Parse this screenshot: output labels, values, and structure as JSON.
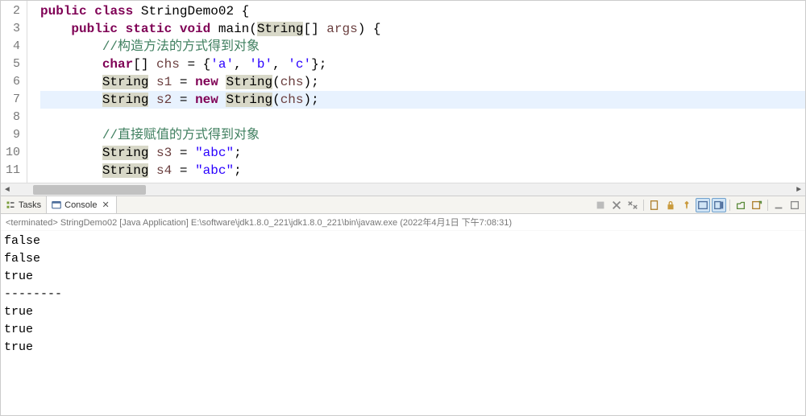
{
  "gutter": [
    "2",
    "3",
    "4",
    "5",
    "6",
    "7",
    "8",
    "9",
    "10",
    "11"
  ],
  "code": {
    "highlight_index": 5,
    "lines": [
      [
        {
          "cls": "kw",
          "t": "public"
        },
        {
          "cls": "plain",
          "t": " "
        },
        {
          "cls": "kw",
          "t": "class"
        },
        {
          "cls": "plain",
          "t": " StringDemo02 {"
        }
      ],
      [
        {
          "cls": "plain",
          "t": "    "
        },
        {
          "cls": "kw",
          "t": "public"
        },
        {
          "cls": "plain",
          "t": " "
        },
        {
          "cls": "kw",
          "t": "static"
        },
        {
          "cls": "plain",
          "t": " "
        },
        {
          "cls": "kw",
          "t": "void"
        },
        {
          "cls": "plain",
          "t": " main("
        },
        {
          "cls": "typehl",
          "t": "String"
        },
        {
          "cls": "plain",
          "t": "[] "
        },
        {
          "cls": "var",
          "t": "args"
        },
        {
          "cls": "plain",
          "t": ") {"
        }
      ],
      [
        {
          "cls": "plain",
          "t": "        "
        },
        {
          "cls": "cmt",
          "t": "//构造方法的方式得到对象"
        }
      ],
      [
        {
          "cls": "plain",
          "t": "        "
        },
        {
          "cls": "kw",
          "t": "char"
        },
        {
          "cls": "plain",
          "t": "[] "
        },
        {
          "cls": "var",
          "t": "chs"
        },
        {
          "cls": "plain",
          "t": " = {"
        },
        {
          "cls": "str",
          "t": "'a'"
        },
        {
          "cls": "plain",
          "t": ", "
        },
        {
          "cls": "str",
          "t": "'b'"
        },
        {
          "cls": "plain",
          "t": ", "
        },
        {
          "cls": "str",
          "t": "'c'"
        },
        {
          "cls": "plain",
          "t": "};"
        }
      ],
      [
        {
          "cls": "plain",
          "t": "        "
        },
        {
          "cls": "typehl",
          "t": "String"
        },
        {
          "cls": "plain",
          "t": " "
        },
        {
          "cls": "var",
          "t": "s1"
        },
        {
          "cls": "plain",
          "t": " = "
        },
        {
          "cls": "kw",
          "t": "new"
        },
        {
          "cls": "plain",
          "t": " "
        },
        {
          "cls": "typehl",
          "t": "String"
        },
        {
          "cls": "plain",
          "t": "("
        },
        {
          "cls": "var",
          "t": "chs"
        },
        {
          "cls": "plain",
          "t": ");"
        }
      ],
      [
        {
          "cls": "plain",
          "t": "        "
        },
        {
          "cls": "typehl",
          "t": "String"
        },
        {
          "cls": "plain",
          "t": " "
        },
        {
          "cls": "var",
          "t": "s2"
        },
        {
          "cls": "plain",
          "t": " = "
        },
        {
          "cls": "kw",
          "t": "new"
        },
        {
          "cls": "plain",
          "t": " "
        },
        {
          "cls": "typehl",
          "t": "String"
        },
        {
          "cls": "plain",
          "t": "("
        },
        {
          "cls": "var",
          "t": "chs"
        },
        {
          "cls": "plain",
          "t": ");"
        }
      ],
      [
        {
          "cls": "plain",
          "t": ""
        }
      ],
      [
        {
          "cls": "plain",
          "t": "        "
        },
        {
          "cls": "cmt",
          "t": "//直接赋值的方式得到对象"
        }
      ],
      [
        {
          "cls": "plain",
          "t": "        "
        },
        {
          "cls": "typehl",
          "t": "String"
        },
        {
          "cls": "plain",
          "t": " "
        },
        {
          "cls": "var",
          "t": "s3"
        },
        {
          "cls": "plain",
          "t": " = "
        },
        {
          "cls": "str",
          "t": "\"abc\""
        },
        {
          "cls": "plain",
          "t": ";"
        }
      ],
      [
        {
          "cls": "plain",
          "t": "        "
        },
        {
          "cls": "typehl",
          "t": "String"
        },
        {
          "cls": "plain",
          "t": " "
        },
        {
          "cls": "var",
          "t": "s4"
        },
        {
          "cls": "plain",
          "t": " = "
        },
        {
          "cls": "str",
          "t": "\"abc\""
        },
        {
          "cls": "plain",
          "t": ";"
        }
      ]
    ]
  },
  "tabs": {
    "tasks_label": "Tasks",
    "console_label": "Console",
    "close_glyph": "✕"
  },
  "console": {
    "header_prefix": "<terminated> ",
    "header_rest": "StringDemo02 [Java Application] E:\\software\\jdk1.8.0_221\\jdk1.8.0_221\\bin\\javaw.exe (2022年4月1日 下午7:08:31)",
    "output": [
      "false",
      "false",
      "true",
      "--------",
      "true",
      "true",
      "true"
    ]
  }
}
